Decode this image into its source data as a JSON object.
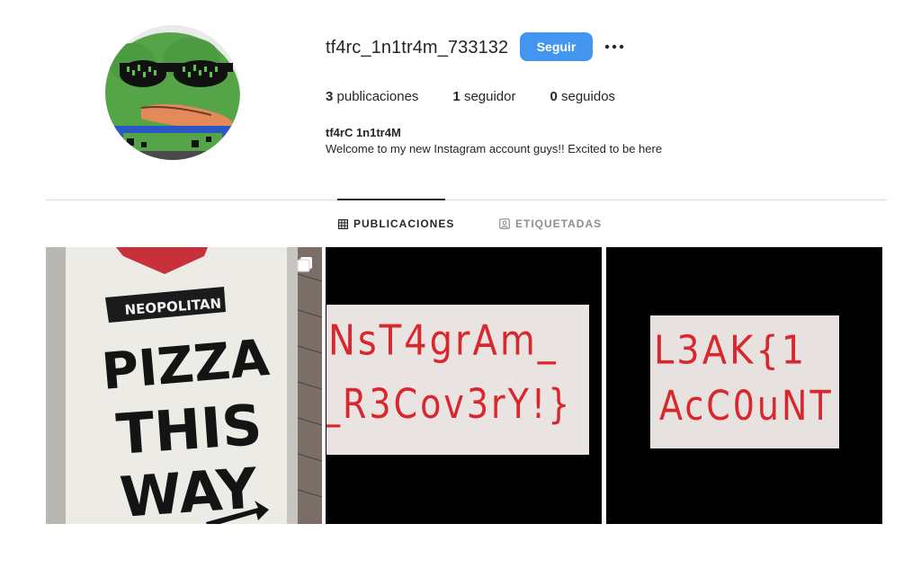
{
  "profile": {
    "username": "tf4rc_1n1tr4m_733132",
    "follow_label": "Seguir",
    "display_name": "tf4rC 1n1tr4M",
    "bio": "Welcome to my new Instagram account guys!! Excited to be here",
    "stats": [
      {
        "count": "3",
        "label": "publicaciones"
      },
      {
        "count": "1",
        "label": "seguidor"
      },
      {
        "count": "0",
        "label": "seguidos"
      }
    ]
  },
  "tabs": {
    "posts": "PUBLICACIONES",
    "tagged": "ETIQUETADAS"
  },
  "posts": [
    {
      "kind": "photo",
      "texts": [
        "NEOPOLITAN",
        "PIZZA",
        "THIS",
        "WAY"
      ],
      "multi": true,
      "icon": "carousel-icon"
    },
    {
      "kind": "handwritten",
      "lines": [
        "NsT4grAm_",
        "_R3Cov3rY!}"
      ]
    },
    {
      "kind": "handwritten",
      "lines": [
        "L3AK{1",
        "AcC0uNT"
      ]
    }
  ],
  "colors": {
    "accent": "#4396f0",
    "text": "#262626",
    "muted": "#8e8e8e",
    "divider": "#dbdbdb",
    "ink": "#d8282d"
  }
}
